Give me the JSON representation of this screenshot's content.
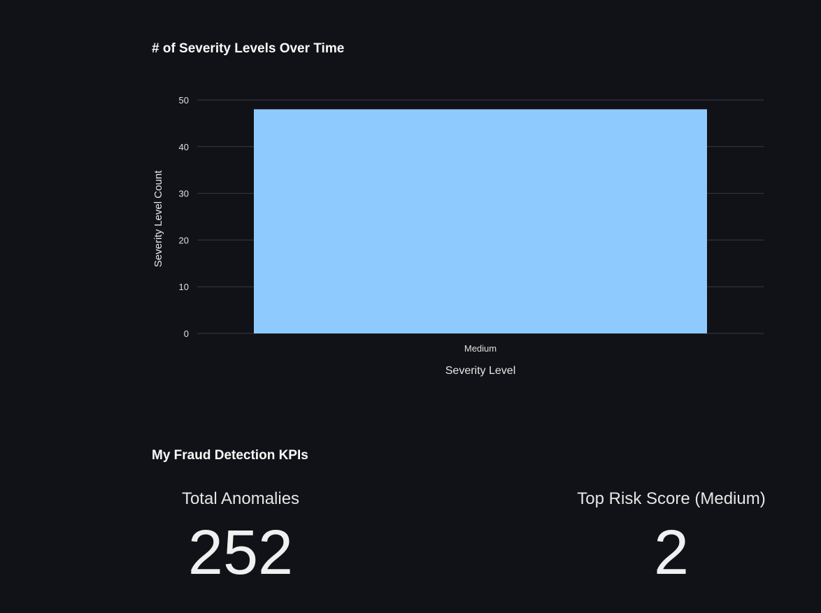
{
  "chart_data": {
    "type": "bar",
    "title": "# of Severity Levels Over Time",
    "xlabel": "Severity Level",
    "ylabel": "Severity Level Count",
    "categories": [
      "Medium"
    ],
    "values": [
      48
    ],
    "ylim": [
      0,
      50
    ],
    "yticks": [
      0,
      10,
      20,
      30,
      40,
      50
    ],
    "grid": true,
    "bar_color": "#8fcaff",
    "grid_color": "#3a3b42"
  },
  "kpi_section": {
    "title": "My Fraud Detection KPIs",
    "kpis": [
      {
        "label": "Total Anomalies",
        "value": "252"
      },
      {
        "label": "Top Risk Score (Medium)",
        "value": "2"
      }
    ]
  },
  "colors": {
    "background": "#111217",
    "text": "#fafafa"
  }
}
